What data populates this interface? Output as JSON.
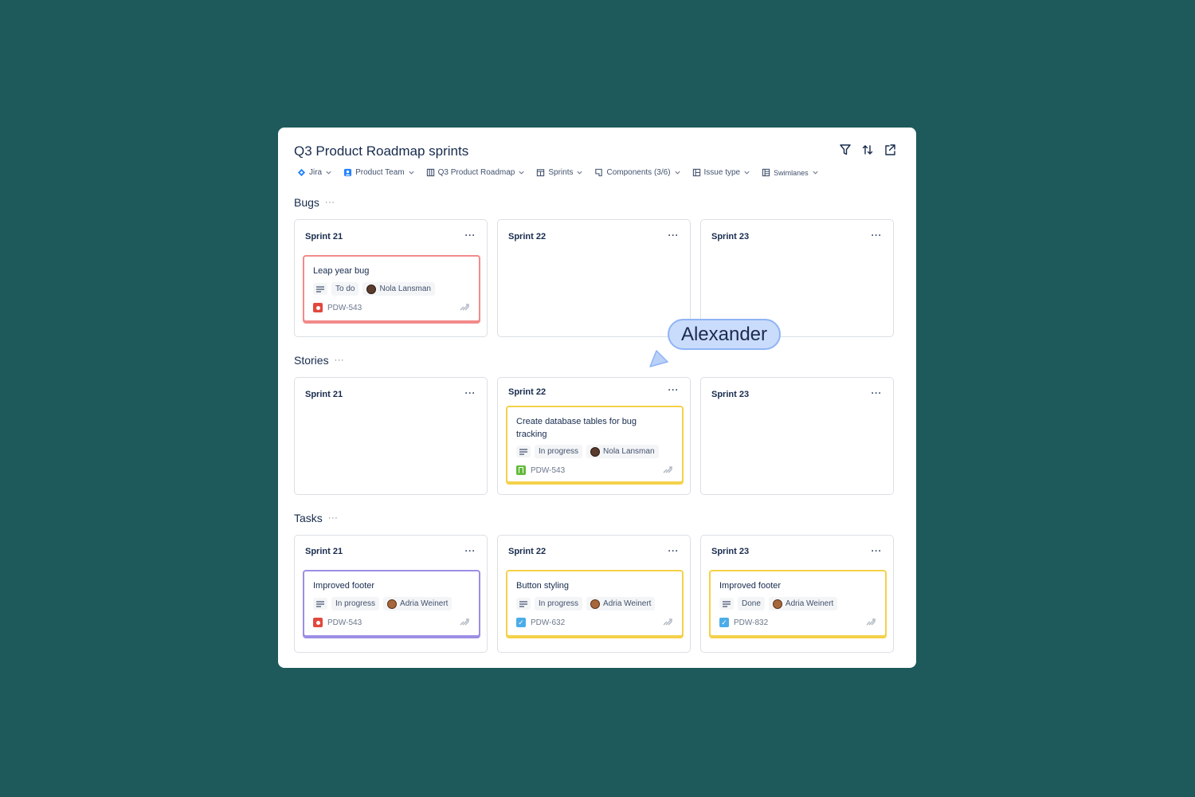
{
  "board": {
    "title": "Q3 Product Roadmap sprints",
    "actions": [
      {
        "name": "filter-icon"
      },
      {
        "name": "sort-icon"
      },
      {
        "name": "open-external-icon"
      }
    ]
  },
  "toolbar": [
    {
      "label": "Jira",
      "icon": "jira-icon"
    },
    {
      "label": "Product Team",
      "icon": "team-icon"
    },
    {
      "label": "Q3 Product Roadmap",
      "icon": "board-icon"
    },
    {
      "label": "Sprints",
      "icon": "sprint-icon"
    },
    {
      "label": "Components (3/6)",
      "icon": "component-icon"
    },
    {
      "label": "Issue type",
      "icon": "issue-type-icon"
    },
    {
      "label": "Swimlanes",
      "icon": "swimlanes-icon"
    }
  ],
  "swimlanes": [
    {
      "name": "Bugs",
      "more": "···",
      "columns": [
        {
          "title": "Sprint 21",
          "more": "···",
          "card": {
            "title": "Leap year bug",
            "status": "To do",
            "assignee": "Nola Lansman",
            "key": "PDW-543",
            "type": "bug-icon",
            "color": "#f28b8b"
          }
        },
        {
          "title": "Sprint 22",
          "more": "···"
        },
        {
          "title": "Sprint 23",
          "more": "···"
        }
      ]
    },
    {
      "name": "Stories",
      "more": "···",
      "columns": [
        {
          "title": "Sprint 21",
          "more": "···"
        },
        {
          "title": "Sprint 22",
          "more": "···",
          "card": {
            "title": "Create database tables for bug tracking",
            "status": "In progress",
            "assignee": "Nola Lansman",
            "key": "PDW-543",
            "type": "story-icon",
            "color": "#f5d14a"
          }
        },
        {
          "title": "Sprint 23",
          "more": "···"
        }
      ]
    },
    {
      "name": "Tasks",
      "more": "···",
      "columns": [
        {
          "title": "Sprint 21",
          "more": "···",
          "card": {
            "title": "Improved footer",
            "status": "In progress",
            "assignee": "Adria Weinert",
            "key": "PDW-543",
            "type": "bug-icon",
            "color": "#9b8fe4"
          }
        },
        {
          "title": "Sprint 22",
          "more": "···",
          "card": {
            "title": "Button styling",
            "status": "In progress",
            "assignee": "Adria Weinert",
            "key": "PDW-632",
            "type": "task-icon",
            "color": "#f5d14a"
          }
        },
        {
          "title": "Sprint 23",
          "more": "···",
          "card": {
            "title": "Improved footer",
            "status": "Done",
            "assignee": "Adria Weinert",
            "key": "PDW-832",
            "type": "task-icon",
            "color": "#f5d14a"
          }
        }
      ]
    }
  ],
  "cursor": {
    "label": "Alexander",
    "color": "#c9dcfb"
  }
}
